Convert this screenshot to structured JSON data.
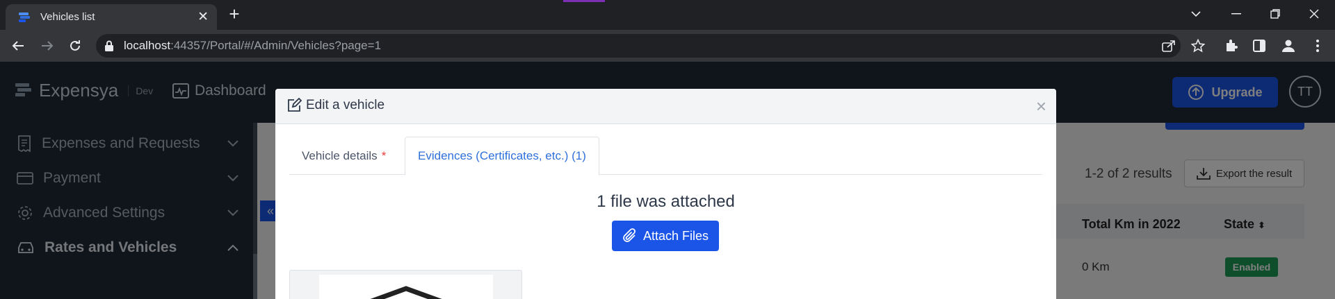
{
  "browser": {
    "tab_title": "Vehicles list",
    "url_host": "localhost",
    "url_path": ":44357/Portal/#/Admin/Vehicles?page=1"
  },
  "app": {
    "brand_name": "Expensya",
    "brand_env": "Dev",
    "nav": {
      "dashboard": "Dashboard"
    },
    "upgrade_label": "Upgrade",
    "avatar_initials": "TT",
    "sidebar": {
      "items": [
        {
          "label": "Expenses and Requests",
          "icon": "receipt-icon"
        },
        {
          "label": "Payment",
          "icon": "card-icon"
        },
        {
          "label": "Advanced Settings",
          "icon": "gear-icon"
        },
        {
          "label": "Rates and Vehicles",
          "icon": "car-icon"
        }
      ]
    },
    "main": {
      "results_text": "1-2 of 2 results",
      "export_label": "Export the result",
      "columns": {
        "total_km": "Total Km in 2022",
        "state": "State"
      },
      "row": {
        "total_km": "0 Km",
        "state": "Enabled"
      }
    }
  },
  "modal": {
    "title": "Edit a vehicle",
    "tabs": {
      "details": "Vehicle details",
      "required_mark": "*",
      "evidences": "Evidences (Certificates, etc.) (1)"
    },
    "attached_text": "1 file was attached",
    "attach_button": "Attach Files"
  },
  "colors": {
    "primary": "#1b55e8",
    "header_bg": "#1e2a36",
    "success": "#1f9d55"
  }
}
